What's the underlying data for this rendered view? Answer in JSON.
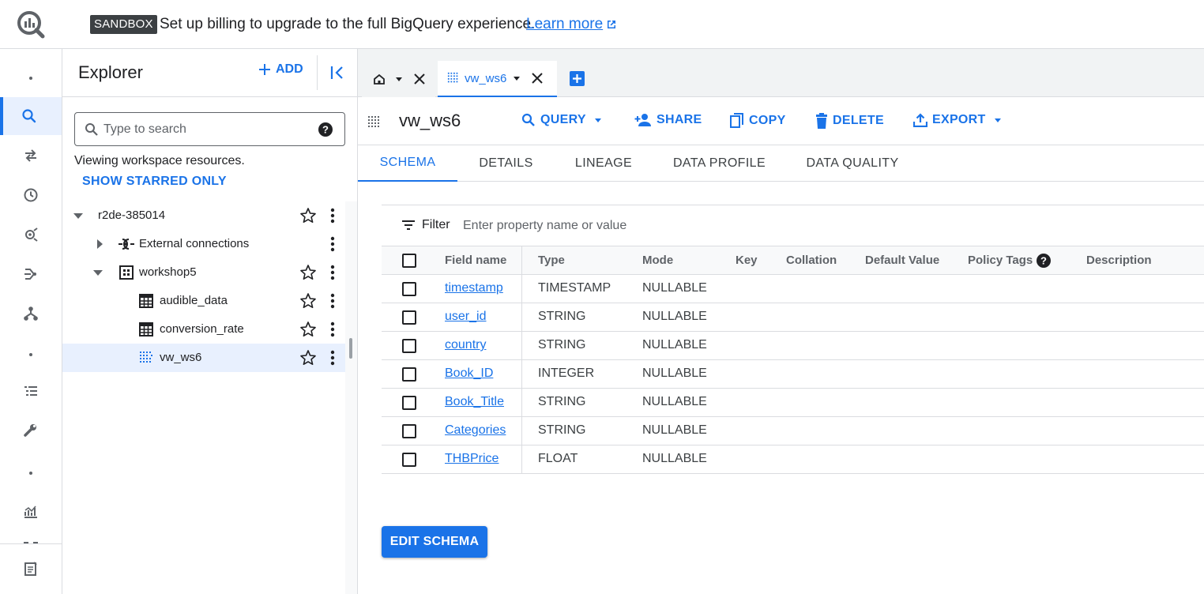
{
  "banner": {
    "badge": "SANDBOX",
    "message": "Set up billing to upgrade to the full BigQuery experience.",
    "link_label": "Learn more"
  },
  "rail": {
    "items": [
      "more-dots",
      "search",
      "transfers",
      "history",
      "analytics-hub",
      "dataflow",
      "dataform",
      "more-dots",
      "queries",
      "tools",
      "more-dots",
      "monitoring",
      "more",
      "release-notes"
    ]
  },
  "explorer": {
    "title": "Explorer",
    "add_label": "ADD",
    "search_placeholder": "Type to search",
    "viewing_text": "Viewing workspace resources.",
    "starred_label": "SHOW STARRED ONLY",
    "tree": [
      {
        "label": "r2de-385014",
        "type": "project",
        "expanded": true,
        "starred": false
      },
      {
        "label": "External connections",
        "type": "connections",
        "expanded": false
      },
      {
        "label": "workshop5",
        "type": "dataset",
        "expanded": true,
        "starred": false
      },
      {
        "label": "audible_data",
        "type": "table",
        "starred": false
      },
      {
        "label": "conversion_rate",
        "type": "table",
        "starred": false
      },
      {
        "label": "vw_ws6",
        "type": "view",
        "starred": false,
        "selected": true
      }
    ]
  },
  "tabs": {
    "view_tab": "vw_ws6"
  },
  "resource": {
    "title": "vw_ws6",
    "actions": {
      "query": "QUERY",
      "share": "SHARE",
      "copy": "COPY",
      "delete": "DELETE",
      "export": "EXPORT"
    }
  },
  "subtabs": [
    "SCHEMA",
    "DETAILS",
    "LINEAGE",
    "DATA PROFILE",
    "DATA QUALITY"
  ],
  "filter": {
    "label": "Filter",
    "placeholder": "Enter property name or value"
  },
  "schema": {
    "columns": [
      "Field name",
      "Type",
      "Mode",
      "Key",
      "Collation",
      "Default Value",
      "Policy Tags",
      "Description"
    ],
    "rows": [
      {
        "name": "timestamp",
        "type": "TIMESTAMP",
        "mode": "NULLABLE"
      },
      {
        "name": "user_id",
        "type": "STRING",
        "mode": "NULLABLE"
      },
      {
        "name": "country",
        "type": "STRING",
        "mode": "NULLABLE"
      },
      {
        "name": "Book_ID",
        "type": "INTEGER",
        "mode": "NULLABLE"
      },
      {
        "name": "Book_Title",
        "type": "STRING",
        "mode": "NULLABLE"
      },
      {
        "name": "Categories",
        "type": "STRING",
        "mode": "NULLABLE"
      },
      {
        "name": "THBPrice",
        "type": "FLOAT",
        "mode": "NULLABLE"
      }
    ],
    "edit_label": "EDIT SCHEMA"
  },
  "colors": {
    "accent": "#1a73e8",
    "badge_bg": "#3c4043",
    "selected_bg": "#e8f0fe"
  }
}
